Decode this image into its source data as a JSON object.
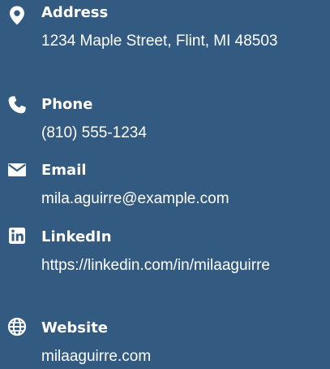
{
  "contact": {
    "address": {
      "icon": "map-pin-icon",
      "label": "Address",
      "value": "1234 Maple Street, Flint, MI 48503"
    },
    "phone": {
      "icon": "phone-icon",
      "label": "Phone",
      "value": "(810) 555-1234"
    },
    "email": {
      "icon": "envelope-icon",
      "label": "Email",
      "value": "mila.aguirre@example.com"
    },
    "linkedin": {
      "icon": "linkedin-icon",
      "label": "LinkedIn",
      "value": "https://linkedin.com/in/milaaguirre"
    },
    "website": {
      "icon": "globe-icon",
      "label": "Website",
      "value": "milaaguirre.com"
    }
  },
  "colors": {
    "background": "#335a80",
    "text": "#ffffff"
  }
}
